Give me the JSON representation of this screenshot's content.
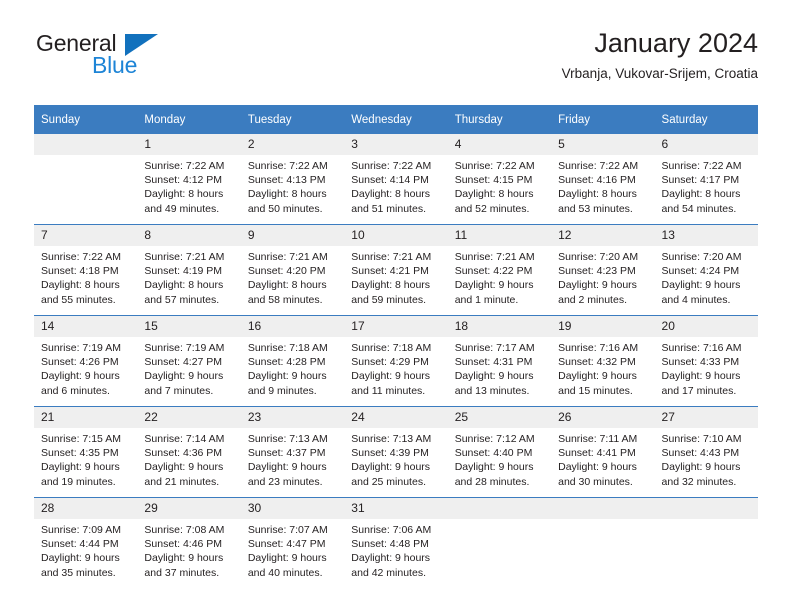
{
  "brand": {
    "name_part1": "General",
    "name_part2": "Blue",
    "color_dark": "#231f20",
    "color_blue": "#1d84d6",
    "triangle_color": "#1271bd"
  },
  "header": {
    "title": "January 2024",
    "subtitle": "Vrbanja, Vukovar-Srijem, Croatia"
  },
  "calendar": {
    "accent_color": "#3b7cc0",
    "daynum_band_color": "#efefef",
    "weekday_headers": [
      "Sunday",
      "Monday",
      "Tuesday",
      "Wednesday",
      "Thursday",
      "Friday",
      "Saturday"
    ],
    "weeks": [
      [
        {
          "day": "",
          "empty": true,
          "sunrise": "",
          "sunset": "",
          "daylight1": "",
          "daylight2": ""
        },
        {
          "day": "1",
          "empty": false,
          "sunrise": "Sunrise: 7:22 AM",
          "sunset": "Sunset: 4:12 PM",
          "daylight1": "Daylight: 8 hours",
          "daylight2": "and 49 minutes."
        },
        {
          "day": "2",
          "empty": false,
          "sunrise": "Sunrise: 7:22 AM",
          "sunset": "Sunset: 4:13 PM",
          "daylight1": "Daylight: 8 hours",
          "daylight2": "and 50 minutes."
        },
        {
          "day": "3",
          "empty": false,
          "sunrise": "Sunrise: 7:22 AM",
          "sunset": "Sunset: 4:14 PM",
          "daylight1": "Daylight: 8 hours",
          "daylight2": "and 51 minutes."
        },
        {
          "day": "4",
          "empty": false,
          "sunrise": "Sunrise: 7:22 AM",
          "sunset": "Sunset: 4:15 PM",
          "daylight1": "Daylight: 8 hours",
          "daylight2": "and 52 minutes."
        },
        {
          "day": "5",
          "empty": false,
          "sunrise": "Sunrise: 7:22 AM",
          "sunset": "Sunset: 4:16 PM",
          "daylight1": "Daylight: 8 hours",
          "daylight2": "and 53 minutes."
        },
        {
          "day": "6",
          "empty": false,
          "sunrise": "Sunrise: 7:22 AM",
          "sunset": "Sunset: 4:17 PM",
          "daylight1": "Daylight: 8 hours",
          "daylight2": "and 54 minutes."
        }
      ],
      [
        {
          "day": "7",
          "empty": false,
          "sunrise": "Sunrise: 7:22 AM",
          "sunset": "Sunset: 4:18 PM",
          "daylight1": "Daylight: 8 hours",
          "daylight2": "and 55 minutes."
        },
        {
          "day": "8",
          "empty": false,
          "sunrise": "Sunrise: 7:21 AM",
          "sunset": "Sunset: 4:19 PM",
          "daylight1": "Daylight: 8 hours",
          "daylight2": "and 57 minutes."
        },
        {
          "day": "9",
          "empty": false,
          "sunrise": "Sunrise: 7:21 AM",
          "sunset": "Sunset: 4:20 PM",
          "daylight1": "Daylight: 8 hours",
          "daylight2": "and 58 minutes."
        },
        {
          "day": "10",
          "empty": false,
          "sunrise": "Sunrise: 7:21 AM",
          "sunset": "Sunset: 4:21 PM",
          "daylight1": "Daylight: 8 hours",
          "daylight2": "and 59 minutes."
        },
        {
          "day": "11",
          "empty": false,
          "sunrise": "Sunrise: 7:21 AM",
          "sunset": "Sunset: 4:22 PM",
          "daylight1": "Daylight: 9 hours",
          "daylight2": "and 1 minute."
        },
        {
          "day": "12",
          "empty": false,
          "sunrise": "Sunrise: 7:20 AM",
          "sunset": "Sunset: 4:23 PM",
          "daylight1": "Daylight: 9 hours",
          "daylight2": "and 2 minutes."
        },
        {
          "day": "13",
          "empty": false,
          "sunrise": "Sunrise: 7:20 AM",
          "sunset": "Sunset: 4:24 PM",
          "daylight1": "Daylight: 9 hours",
          "daylight2": "and 4 minutes."
        }
      ],
      [
        {
          "day": "14",
          "empty": false,
          "sunrise": "Sunrise: 7:19 AM",
          "sunset": "Sunset: 4:26 PM",
          "daylight1": "Daylight: 9 hours",
          "daylight2": "and 6 minutes."
        },
        {
          "day": "15",
          "empty": false,
          "sunrise": "Sunrise: 7:19 AM",
          "sunset": "Sunset: 4:27 PM",
          "daylight1": "Daylight: 9 hours",
          "daylight2": "and 7 minutes."
        },
        {
          "day": "16",
          "empty": false,
          "sunrise": "Sunrise: 7:18 AM",
          "sunset": "Sunset: 4:28 PM",
          "daylight1": "Daylight: 9 hours",
          "daylight2": "and 9 minutes."
        },
        {
          "day": "17",
          "empty": false,
          "sunrise": "Sunrise: 7:18 AM",
          "sunset": "Sunset: 4:29 PM",
          "daylight1": "Daylight: 9 hours",
          "daylight2": "and 11 minutes."
        },
        {
          "day": "18",
          "empty": false,
          "sunrise": "Sunrise: 7:17 AM",
          "sunset": "Sunset: 4:31 PM",
          "daylight1": "Daylight: 9 hours",
          "daylight2": "and 13 minutes."
        },
        {
          "day": "19",
          "empty": false,
          "sunrise": "Sunrise: 7:16 AM",
          "sunset": "Sunset: 4:32 PM",
          "daylight1": "Daylight: 9 hours",
          "daylight2": "and 15 minutes."
        },
        {
          "day": "20",
          "empty": false,
          "sunrise": "Sunrise: 7:16 AM",
          "sunset": "Sunset: 4:33 PM",
          "daylight1": "Daylight: 9 hours",
          "daylight2": "and 17 minutes."
        }
      ],
      [
        {
          "day": "21",
          "empty": false,
          "sunrise": "Sunrise: 7:15 AM",
          "sunset": "Sunset: 4:35 PM",
          "daylight1": "Daylight: 9 hours",
          "daylight2": "and 19 minutes."
        },
        {
          "day": "22",
          "empty": false,
          "sunrise": "Sunrise: 7:14 AM",
          "sunset": "Sunset: 4:36 PM",
          "daylight1": "Daylight: 9 hours",
          "daylight2": "and 21 minutes."
        },
        {
          "day": "23",
          "empty": false,
          "sunrise": "Sunrise: 7:13 AM",
          "sunset": "Sunset: 4:37 PM",
          "daylight1": "Daylight: 9 hours",
          "daylight2": "and 23 minutes."
        },
        {
          "day": "24",
          "empty": false,
          "sunrise": "Sunrise: 7:13 AM",
          "sunset": "Sunset: 4:39 PM",
          "daylight1": "Daylight: 9 hours",
          "daylight2": "and 25 minutes."
        },
        {
          "day": "25",
          "empty": false,
          "sunrise": "Sunrise: 7:12 AM",
          "sunset": "Sunset: 4:40 PM",
          "daylight1": "Daylight: 9 hours",
          "daylight2": "and 28 minutes."
        },
        {
          "day": "26",
          "empty": false,
          "sunrise": "Sunrise: 7:11 AM",
          "sunset": "Sunset: 4:41 PM",
          "daylight1": "Daylight: 9 hours",
          "daylight2": "and 30 minutes."
        },
        {
          "day": "27",
          "empty": false,
          "sunrise": "Sunrise: 7:10 AM",
          "sunset": "Sunset: 4:43 PM",
          "daylight1": "Daylight: 9 hours",
          "daylight2": "and 32 minutes."
        }
      ],
      [
        {
          "day": "28",
          "empty": false,
          "sunrise": "Sunrise: 7:09 AM",
          "sunset": "Sunset: 4:44 PM",
          "daylight1": "Daylight: 9 hours",
          "daylight2": "and 35 minutes."
        },
        {
          "day": "29",
          "empty": false,
          "sunrise": "Sunrise: 7:08 AM",
          "sunset": "Sunset: 4:46 PM",
          "daylight1": "Daylight: 9 hours",
          "daylight2": "and 37 minutes."
        },
        {
          "day": "30",
          "empty": false,
          "sunrise": "Sunrise: 7:07 AM",
          "sunset": "Sunset: 4:47 PM",
          "daylight1": "Daylight: 9 hours",
          "daylight2": "and 40 minutes."
        },
        {
          "day": "31",
          "empty": false,
          "sunrise": "Sunrise: 7:06 AM",
          "sunset": "Sunset: 4:48 PM",
          "daylight1": "Daylight: 9 hours",
          "daylight2": "and 42 minutes."
        },
        {
          "day": "",
          "empty": true,
          "sunrise": "",
          "sunset": "",
          "daylight1": "",
          "daylight2": ""
        },
        {
          "day": "",
          "empty": true,
          "sunrise": "",
          "sunset": "",
          "daylight1": "",
          "daylight2": ""
        },
        {
          "day": "",
          "empty": true,
          "sunrise": "",
          "sunset": "",
          "daylight1": "",
          "daylight2": ""
        }
      ]
    ]
  }
}
